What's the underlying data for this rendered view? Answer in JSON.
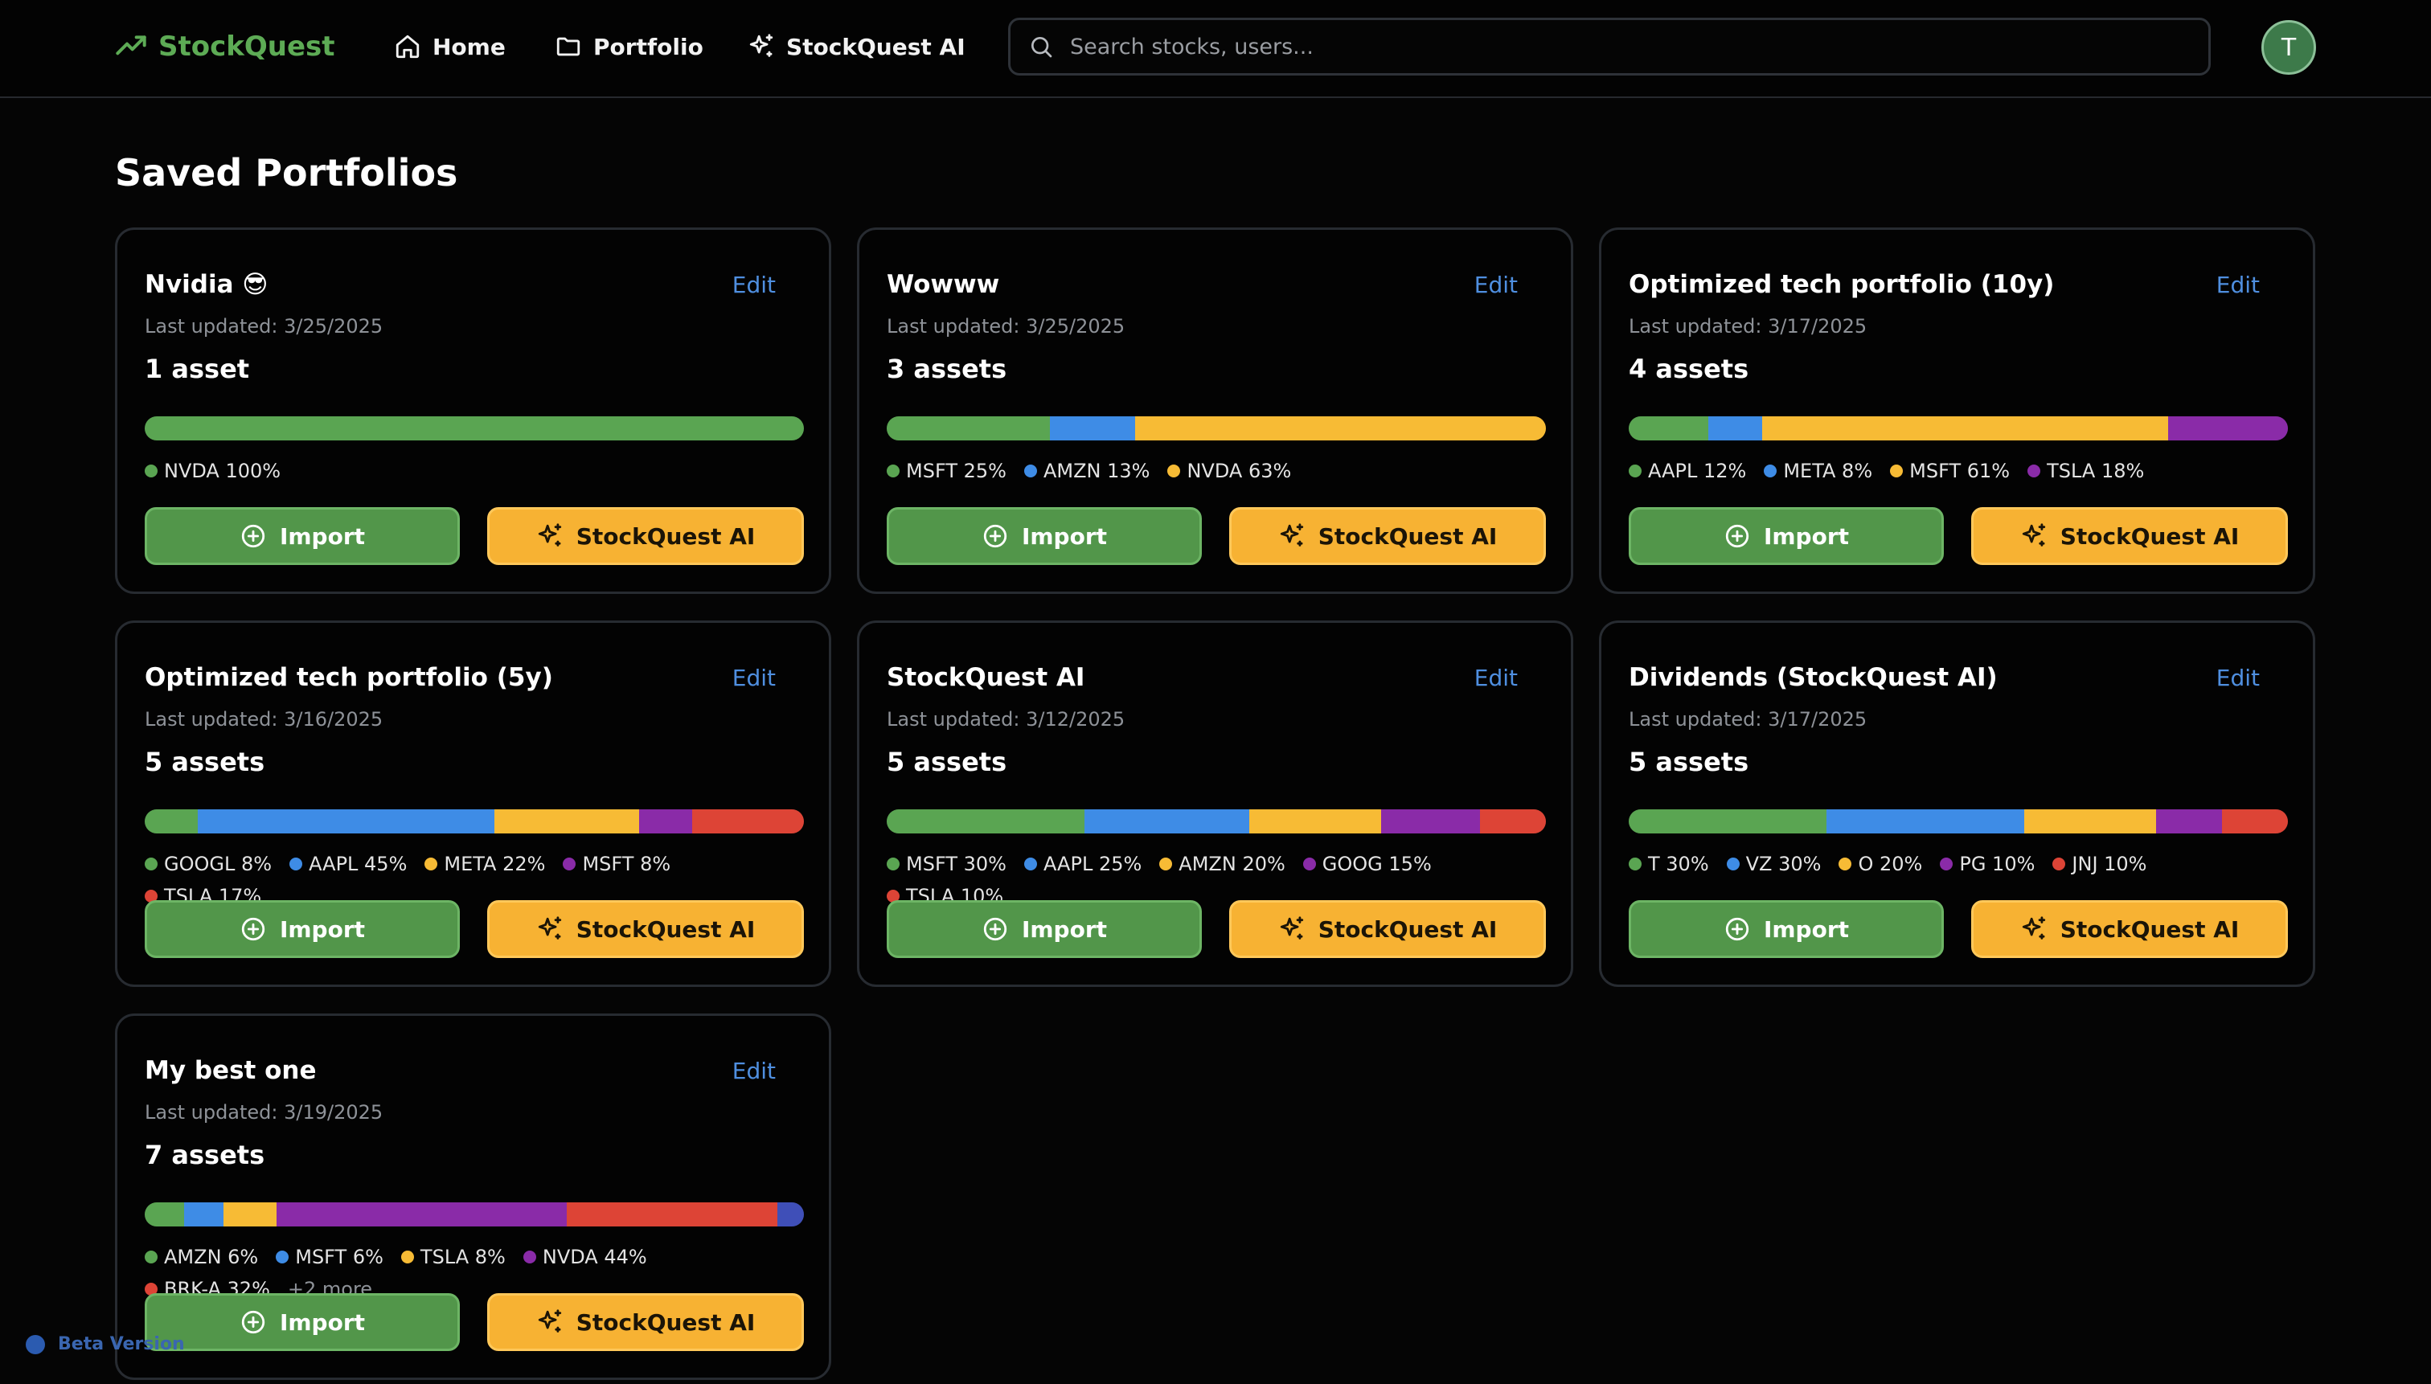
{
  "header": {
    "brand": "StockQuest",
    "nav": [
      {
        "label": "Home"
      },
      {
        "label": "Portfolio"
      },
      {
        "label": "StockQuest AI"
      }
    ],
    "search_placeholder": "Search stocks, users...",
    "avatar_initial": "T"
  },
  "page_title": "Saved Portfolios",
  "edit_label": "Edit",
  "import_label": "Import",
  "ai_label": "StockQuest AI",
  "colors": {
    "green": "#5aa552",
    "blue": "#3e8ce6",
    "yellow": "#f7bb35",
    "purple": "#8a2ba8",
    "red": "#dd4436",
    "indigo": "#3f4fb8"
  },
  "portfolios": [
    {
      "title": "Nvidia 😎",
      "updated": "Last updated: 3/25/2025",
      "asset_count": "1 asset",
      "allocations": [
        {
          "label": "NVDA 100%",
          "pct": 100,
          "color": "green"
        }
      ],
      "more": ""
    },
    {
      "title": "Wowww",
      "updated": "Last updated: 3/25/2025",
      "asset_count": "3 assets",
      "allocations": [
        {
          "label": "MSFT 25%",
          "pct": 25,
          "color": "green"
        },
        {
          "label": "AMZN 13%",
          "pct": 13,
          "color": "blue"
        },
        {
          "label": "NVDA 63%",
          "pct": 63,
          "color": "yellow"
        }
      ],
      "more": ""
    },
    {
      "title": "Optimized tech portfolio (10y)",
      "updated": "Last updated: 3/17/2025",
      "asset_count": "4 assets",
      "allocations": [
        {
          "label": "AAPL 12%",
          "pct": 12,
          "color": "green"
        },
        {
          "label": "META 8%",
          "pct": 8,
          "color": "blue"
        },
        {
          "label": "MSFT 61%",
          "pct": 61,
          "color": "yellow"
        },
        {
          "label": "TSLA 18%",
          "pct": 18,
          "color": "purple"
        }
      ],
      "more": ""
    },
    {
      "title": "Optimized tech portfolio (5y)",
      "updated": "Last updated: 3/16/2025",
      "asset_count": "5 assets",
      "allocations": [
        {
          "label": "GOOGL 8%",
          "pct": 8,
          "color": "green"
        },
        {
          "label": "AAPL 45%",
          "pct": 45,
          "color": "blue"
        },
        {
          "label": "META 22%",
          "pct": 22,
          "color": "yellow"
        },
        {
          "label": "MSFT 8%",
          "pct": 8,
          "color": "purple"
        },
        {
          "label": "TSLA 17%",
          "pct": 17,
          "color": "red"
        }
      ],
      "more": ""
    },
    {
      "title": "StockQuest AI",
      "updated": "Last updated: 3/12/2025",
      "asset_count": "5 assets",
      "allocations": [
        {
          "label": "MSFT 30%",
          "pct": 30,
          "color": "green"
        },
        {
          "label": "AAPL 25%",
          "pct": 25,
          "color": "blue"
        },
        {
          "label": "AMZN 20%",
          "pct": 20,
          "color": "yellow"
        },
        {
          "label": "GOOG 15%",
          "pct": 15,
          "color": "purple"
        },
        {
          "label": "TSLA 10%",
          "pct": 10,
          "color": "red"
        }
      ],
      "more": ""
    },
    {
      "title": "Dividends (StockQuest AI)",
      "updated": "Last updated: 3/17/2025",
      "asset_count": "5 assets",
      "allocations": [
        {
          "label": "T 30%",
          "pct": 30,
          "color": "green"
        },
        {
          "label": "VZ 30%",
          "pct": 30,
          "color": "blue"
        },
        {
          "label": "O 20%",
          "pct": 20,
          "color": "yellow"
        },
        {
          "label": "PG 10%",
          "pct": 10,
          "color": "purple"
        },
        {
          "label": "JNJ 10%",
          "pct": 10,
          "color": "red"
        }
      ],
      "more": ""
    },
    {
      "title": "My best one",
      "updated": "Last updated: 3/19/2025",
      "asset_count": "7 assets",
      "allocations": [
        {
          "label": "AMZN 6%",
          "pct": 6,
          "color": "green"
        },
        {
          "label": "MSFT 6%",
          "pct": 6,
          "color": "blue"
        },
        {
          "label": "TSLA 8%",
          "pct": 8,
          "color": "yellow"
        },
        {
          "label": "NVDA 44%",
          "pct": 44,
          "color": "purple"
        },
        {
          "label": "BRK-A 32%",
          "pct": 32,
          "color": "red"
        }
      ],
      "hidden_segments": [
        {
          "pct": 4,
          "color": "indigo"
        }
      ],
      "more": "+2 more"
    }
  ],
  "beta_label": "Beta Version"
}
